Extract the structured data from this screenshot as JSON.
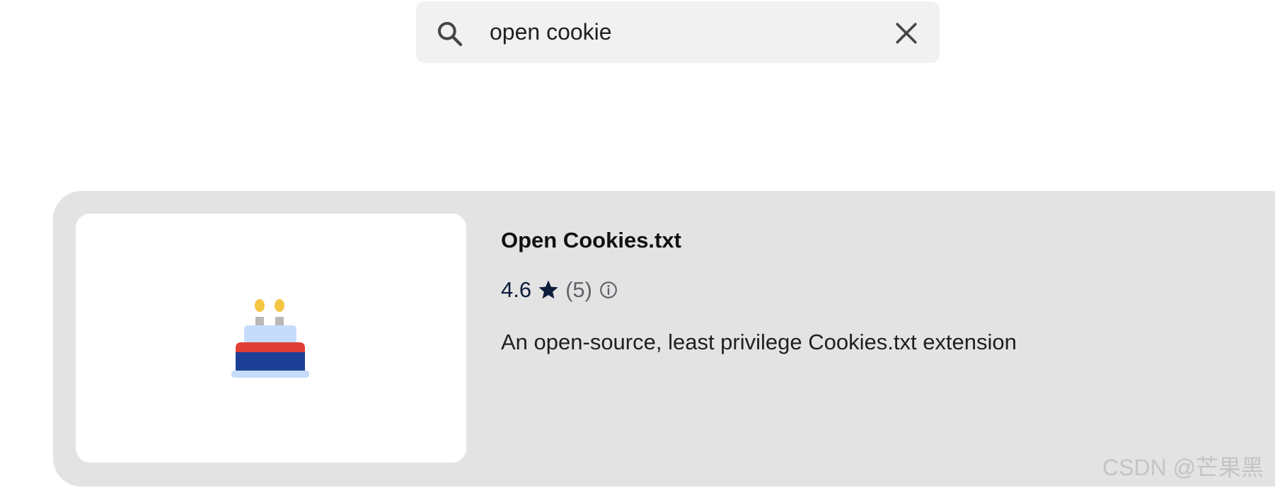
{
  "search": {
    "value": "open cookie",
    "icon": "search-icon",
    "clear_icon": "close-icon"
  },
  "result": {
    "title": "Open Cookies.txt",
    "rating": "4.6",
    "rating_count": "(5)",
    "description": "An open-source, least privilege Cookies.txt extension",
    "icon": "birthday-cake-icon"
  },
  "watermark": "CSDN @芒果黑",
  "colors": {
    "card_background": "#e3e3e3",
    "search_background": "#f1f1f1",
    "rating_text": "#0b1d3a",
    "cake_candle_flame": "#f4c542",
    "cake_top": "#c6dcfb",
    "cake_red_band": "#df3f35",
    "cake_blue_base": "#1d3f96"
  }
}
